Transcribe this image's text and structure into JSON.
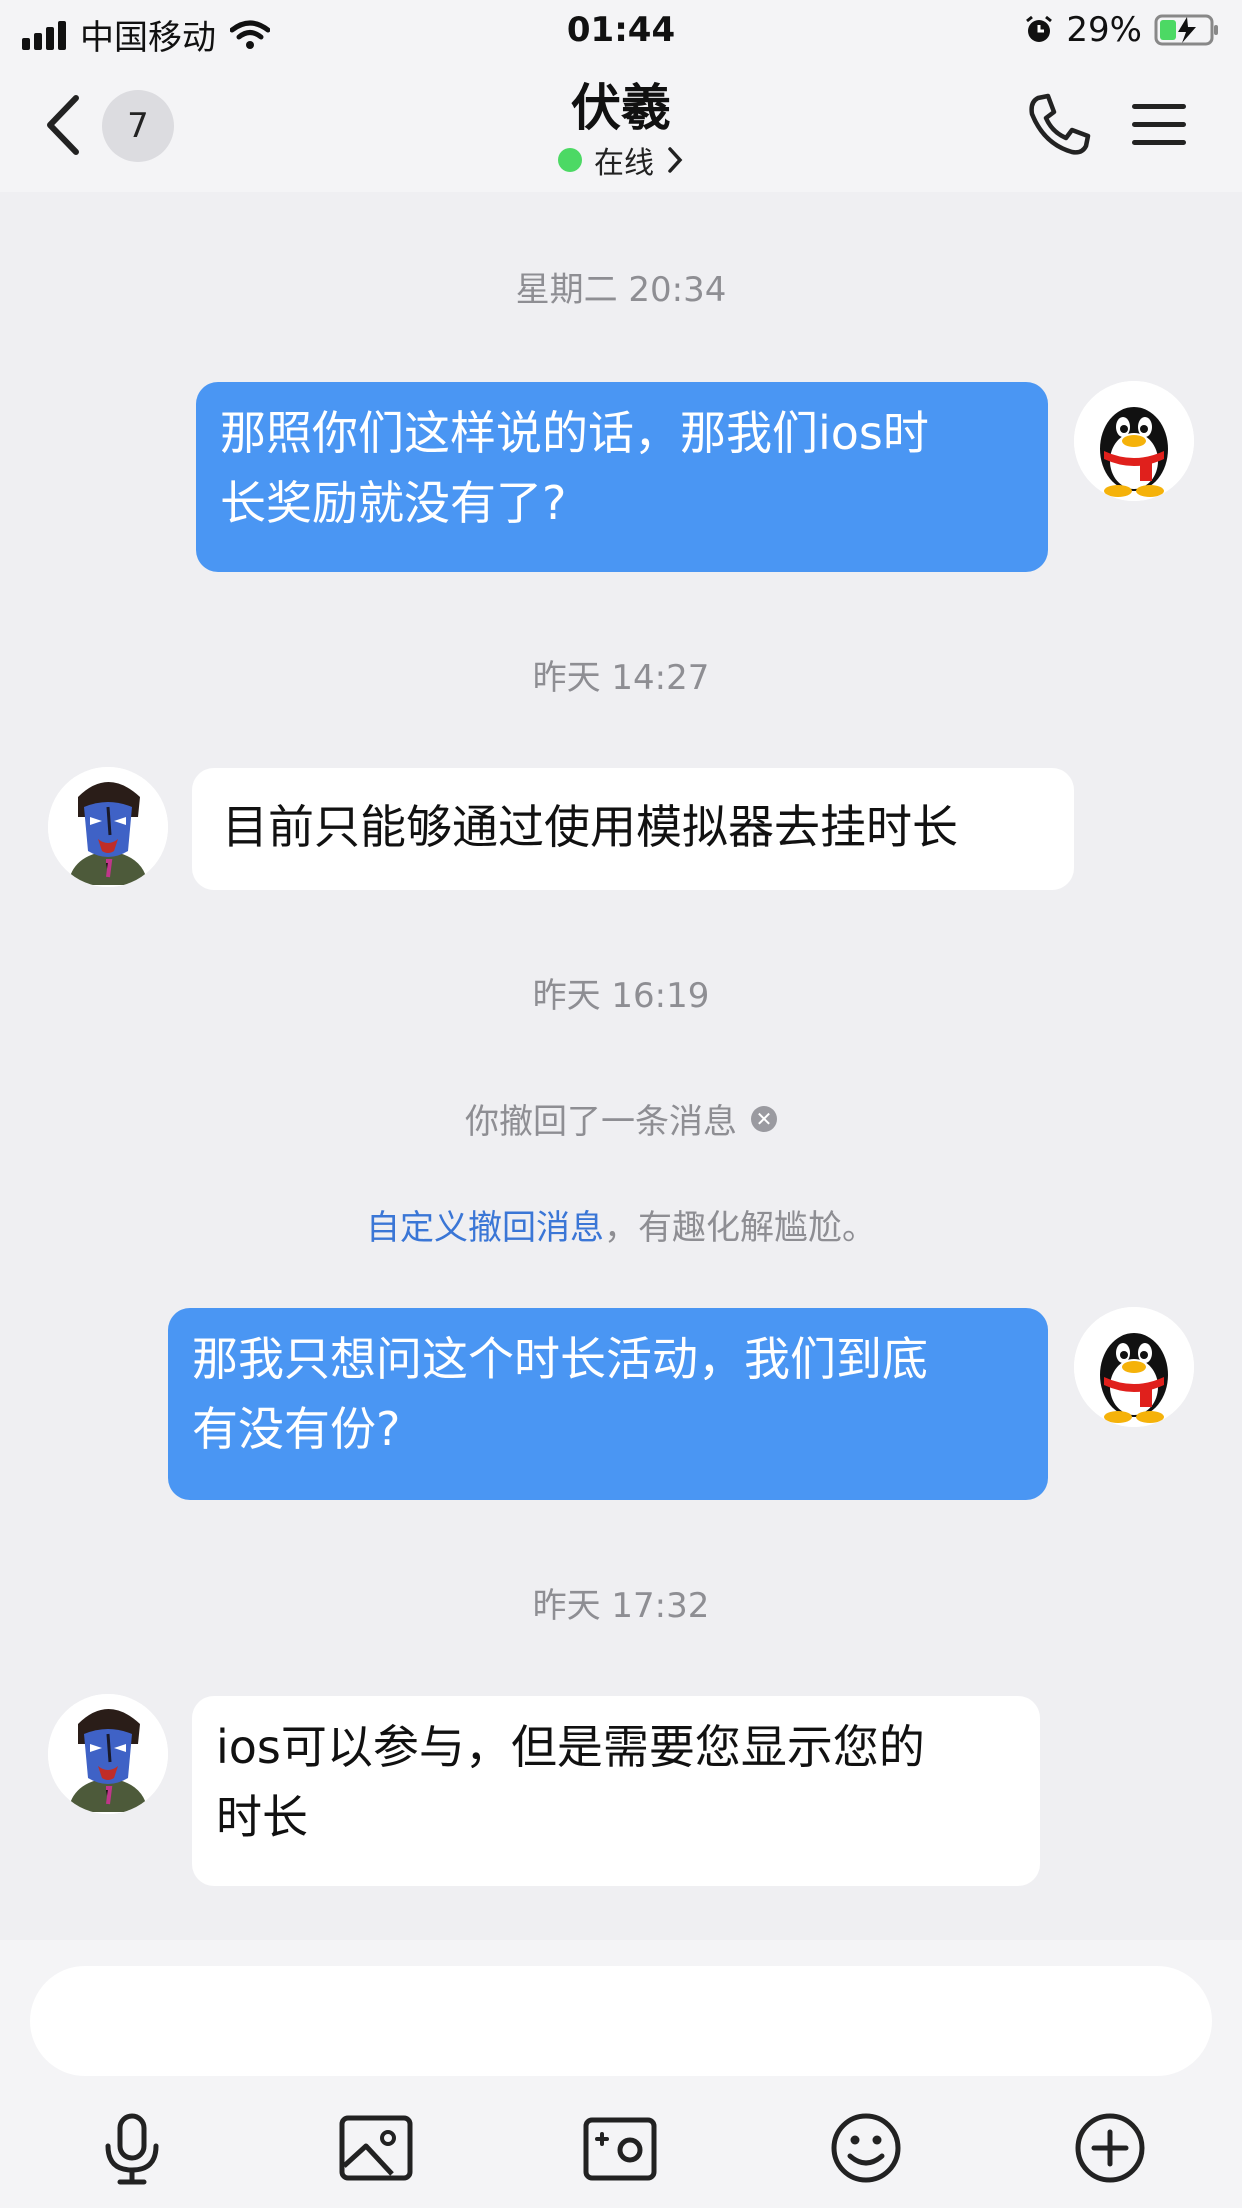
{
  "status_bar": {
    "carrier": "中国移动",
    "time": "01:44",
    "battery": "29%",
    "icons": [
      "signal-icon",
      "wifi-icon",
      "alarm-icon",
      "battery-charging-icon"
    ]
  },
  "nav": {
    "unread_count": "7",
    "title": "伏羲",
    "status": "在线",
    "icons": [
      "back-icon",
      "phone-icon",
      "menu-icon",
      "chevron-right-icon"
    ],
    "online_color": "#4cd964"
  },
  "messages": {
    "ts1": "星期二 20:34",
    "m1": [
      "那照你们这样说的话，那我们ios时",
      "长奖励就没有了?"
    ],
    "ts2": "昨天 14:27",
    "m2": "目前只能够通过使用模拟器去挂时长",
    "ts3": "昨天 16:19",
    "recall": "你撤回了一条消息",
    "tip_link": "自定义撤回消息",
    "tip_rest": "，有趣化解尴尬。",
    "m3": [
      "那我只想问这个时长活动，我们到底",
      "有没有份?"
    ],
    "ts4": "昨天 17:32",
    "m4": [
      "ios可以参与，但是需要您显示您的",
      "时长"
    ]
  },
  "colors": {
    "my_bubble": "#4a96f3",
    "their_bubble": "#ffffff",
    "background": "#efeff2",
    "link": "#3a76d6"
  },
  "input": {
    "placeholder": "",
    "toolbar": [
      "microphone-icon",
      "image-icon",
      "camera-icon",
      "emoji-icon",
      "plus-icon"
    ]
  }
}
